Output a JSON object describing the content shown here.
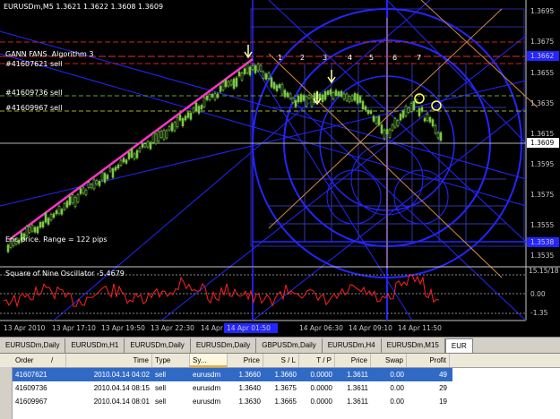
{
  "chart": {
    "header": "EURUSDm,M5  1.3621 1.3622 1.3608 1.3609",
    "indicator_name": "GANN FANS. Algorithm 3",
    "order_labels": [
      "#41607621 sell",
      "#41609736 sell",
      "#41609967 sell"
    ],
    "range_text": "Enc.price. Range = 122 pips",
    "fan_numbers": [
      "1",
      "2",
      "3",
      "4",
      "5",
      "6",
      "7"
    ],
    "oscillator_label": "Square of Nine Oscillator -5.4679",
    "price_ticks": [
      "1.3695",
      "1.3675",
      "1.3655",
      "1.3635",
      "1.3615",
      "1.3595",
      "1.3575",
      "1.3555",
      "1.3535"
    ],
    "highlighted_prices": [
      "1.3662",
      "1.3609",
      "1.3538"
    ],
    "osc_ticks": [
      "15.15/18",
      "0.00",
      "-1.35"
    ],
    "time_ticks": [
      "13 Apr 2010",
      "13 Apr 17:10",
      "13 Apr 19:50",
      "13 Apr 22:30",
      "14 Apr",
      "14 Apr 06:30",
      "14 Apr 09:10",
      "14 Apr 11:50"
    ],
    "highlighted_time": "14 Apr 01:50",
    "colors": {
      "background": "#000000",
      "grid": "#2a2a7a",
      "fan": "#3030ff",
      "pink": "#ff33cc",
      "orange": "#d08a40",
      "candle": "#7ac843",
      "osc": "#ff2020"
    }
  },
  "tabs": [
    "EURUSDm,Daily",
    "EURUSDm,H1",
    "EURUSDm,Daily",
    "EURUSDm,Daily",
    "GBPUSDm,Daily",
    "EURUSDm,H4",
    "EURUSDm,M15",
    "EUR"
  ],
  "terminal": {
    "columns": [
      "Order",
      "/",
      "Time",
      "Type",
      "Sy...",
      "Price",
      "S / L",
      "T / P",
      "Price",
      "Swap",
      "Profit"
    ],
    "rows": [
      {
        "order": "41607621",
        "time": "2010.04.14 04:02",
        "type": "sell",
        "symbol": "eurusdm",
        "price": "1.3660",
        "sl": "1.3660",
        "tp": "0.0000",
        "cur": "1.3611",
        "swap": "0.00",
        "profit": "49",
        "selected": true
      },
      {
        "order": "41609736",
        "time": "2010.04.14 08:15",
        "type": "sell",
        "symbol": "eurusdm",
        "price": "1.3640",
        "sl": "1.3675",
        "tp": "0.0000",
        "cur": "1.3611",
        "swap": "0.00",
        "profit": "29",
        "selected": false
      },
      {
        "order": "41609967",
        "time": "2010.04.14 08:01",
        "type": "sell",
        "symbol": "eurusdm",
        "price": "1.3630",
        "sl": "1.3665",
        "tp": "0.0000",
        "cur": "1.3611",
        "swap": "0.00",
        "profit": "19",
        "selected": false
      }
    ]
  }
}
